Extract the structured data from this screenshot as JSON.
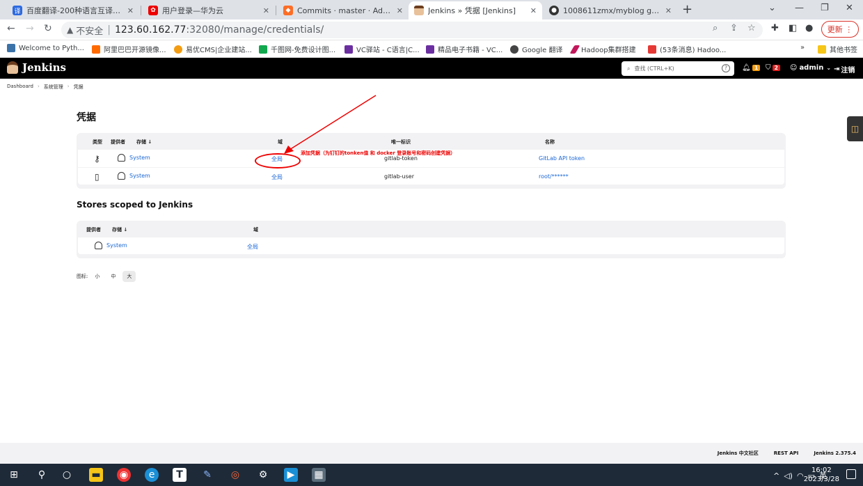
{
  "browser": {
    "tabs": [
      {
        "title": "百度翻译-200种语言互译、沟通",
        "active": false
      },
      {
        "title": "用户登录—华为云",
        "active": false
      },
      {
        "title": "Commits · master · Administrat",
        "active": false
      },
      {
        "title": "Jenkins » 凭据 [Jenkins]",
        "active": true
      },
      {
        "title": "1008611zmx/myblog general",
        "active": false
      }
    ],
    "address": {
      "security_label": "不安全",
      "host": "123.60.162.77",
      "path": ":32080/manage/credentials/"
    },
    "update_label": "更新",
    "bookmarks": [
      {
        "label": "Welcome to Pyth...",
        "color": "#3b73a8"
      },
      {
        "label": "阿里巴巴开源镜像...",
        "color": "#ff6a00"
      },
      {
        "label": "易优CMS|企业建站...",
        "color": "#f39c12"
      },
      {
        "label": "千图网-免费设计图...",
        "color": "#11a84e"
      },
      {
        "label": "VC驿站 - C语言|C...",
        "color": "#6b2fa0"
      },
      {
        "label": "精品电子书籍 - VC...",
        "color": "#6b2fa0"
      },
      {
        "label": "Google 翻译",
        "color": "#444444"
      },
      {
        "label": "Hadoop集群搭建",
        "color": "#c2185b"
      },
      {
        "label": "(53条消息) Hadoo...",
        "color": "#e53935"
      }
    ],
    "other_bookmarks": "其他书签"
  },
  "jenkins": {
    "logo": "Jenkins",
    "search_placeholder": "查找 (CTRL+K)",
    "notifications_count": "1",
    "security_count": "2",
    "user": "admin",
    "logout": "注销",
    "breadcrumb": [
      "Dashboard",
      "系统管理",
      "凭据"
    ],
    "page_title": "凭据",
    "credentials_table": {
      "headers": {
        "type": "类型",
        "provider": "提供者",
        "store": "存储 ↓",
        "domain": "域",
        "id": "唯一标识",
        "name": "名称"
      },
      "rows": [
        {
          "provider": "System",
          "domain": "全局",
          "id": "gitlab-token",
          "name": "GitLab API token"
        },
        {
          "provider": "System",
          "domain": "全局",
          "id": "gitlab-user",
          "name": "root/******"
        }
      ]
    },
    "annotation": "添加凭据（为钉钉的tonken值 和 docker 登录账号和密码创建凭据）",
    "stores_title": "Stores scoped to Jenkins",
    "stores_table": {
      "headers": {
        "provider": "提供者",
        "store": "存储 ↓",
        "domain": "域"
      },
      "rows": [
        {
          "provider": "System",
          "domain": "全局"
        }
      ]
    },
    "icon_size": {
      "label": "图标:",
      "options": [
        "小",
        "中",
        "大"
      ],
      "selected": "大"
    },
    "footer": [
      "Jenkins 中文社区",
      "REST API",
      "Jenkins 2.375.4"
    ]
  },
  "taskbar": {
    "ime": "英",
    "time": "16:02",
    "date": "2023/3/28"
  }
}
